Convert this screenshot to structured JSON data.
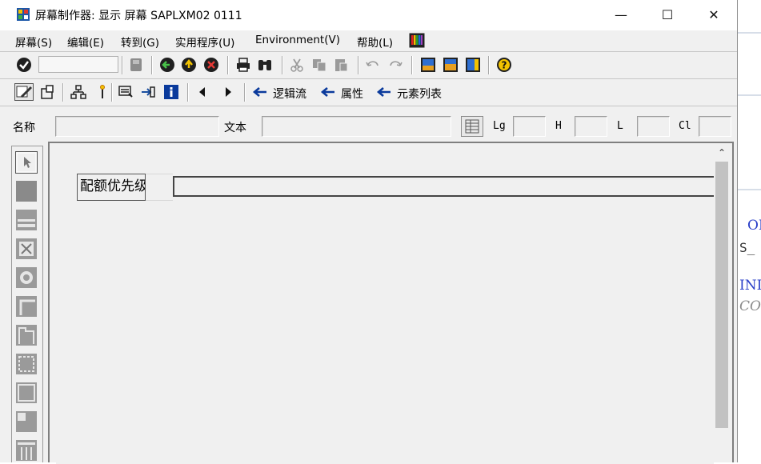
{
  "window": {
    "title": "屏幕制作器: 显示 屏幕 SAPLXM02 0111",
    "minimize_glyph": "—",
    "maximize_glyph": "☐",
    "close_glyph": "✕"
  },
  "menubar": {
    "items": [
      {
        "label": "屏幕(S)"
      },
      {
        "label": "编辑(E)"
      },
      {
        "label": "转到(G)"
      },
      {
        "label": "实用程序(U)"
      },
      {
        "label": "Environment(V)"
      },
      {
        "label": "帮助(L)"
      }
    ]
  },
  "toolbar2": {
    "flow_logic": "逻辑流",
    "attributes": "属性",
    "element_list": "元素列表"
  },
  "attrbar": {
    "name_label": "名称",
    "name_value": "",
    "text_label": "文本",
    "text_value": "",
    "lg_label": "Lg",
    "h_label": "H",
    "l_label": "L",
    "cl_label": "Cl"
  },
  "canvas": {
    "label_text": "配额优先级",
    "input_value": ""
  },
  "background_editor": {
    "line1": "OF",
    "line2": "S_",
    "line3": "INI",
    "line4": "CO"
  },
  "colors": {
    "accent_blue": "#0a3a9c",
    "ok_green": "#1e7a1e",
    "cancel_red": "#c0392b"
  }
}
